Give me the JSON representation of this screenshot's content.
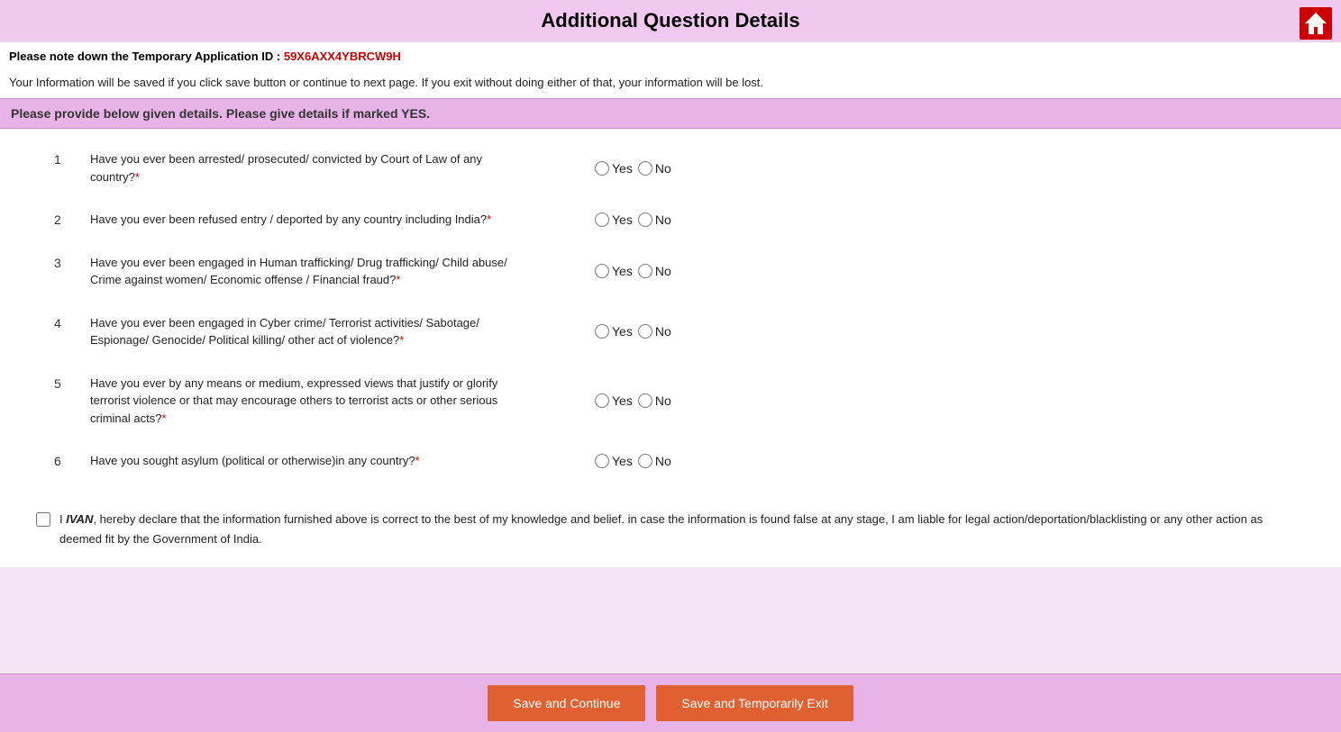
{
  "header": {
    "title": "Additional Question Details"
  },
  "tempId": {
    "label": "Please note down the Temporary Application ID :",
    "value": "59X6AXX4YBRCW9H"
  },
  "infoText": "Your Information will be saved if you click save button or continue to next page. If you exit without doing either of that, your information will be lost.",
  "instructionBar": "Please provide below given details. Please give details if marked YES.",
  "questions": [
    {
      "number": "1",
      "text": "Have you ever been arrested/ prosecuted/ convicted by Court of Law of any country?",
      "required": true
    },
    {
      "number": "2",
      "text": "Have you ever been refused entry / deported by any country including India?",
      "required": true
    },
    {
      "number": "3",
      "text": "Have you ever been engaged in Human trafficking/ Drug trafficking/ Child abuse/ Crime against women/ Economic offense / Financial fraud?",
      "required": true
    },
    {
      "number": "4",
      "text": "Have you ever been engaged in Cyber crime/ Terrorist activities/ Sabotage/ Espionage/ Genocide/ Political killing/ other act of violence?",
      "required": true
    },
    {
      "number": "5",
      "text": "Have you ever by any means or medium, expressed views that justify or glorify terrorist violence or that may encourage others to terrorist acts or other serious criminal acts?",
      "required": true
    },
    {
      "number": "6",
      "text": "Have you sought asylum (political or otherwise)in any country?",
      "required": true
    }
  ],
  "radioOptions": {
    "yes": "Yes",
    "no": "No"
  },
  "declaration": {
    "name": "IVAN",
    "text_before": "I ",
    "text_after": ", hereby declare that the information furnished above is correct to the best of my knowledge and belief. in case the information is found false at any stage, I am liable for legal action/deportation/blacklisting or any other action as deemed fit by the Government of India."
  },
  "buttons": {
    "save_continue": "Save and Continue",
    "save_exit": "Save and Temporarily Exit"
  }
}
